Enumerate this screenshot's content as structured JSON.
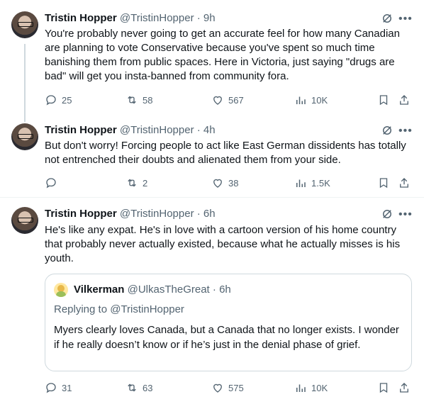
{
  "tweets": [
    {
      "name": "Tristin Hopper",
      "handle": "@TristinHopper",
      "time": "9h",
      "text": "You're probably never going to get an accurate feel for how many Canadian are planning to vote Conservative because you've spent so much time banishing them from public spaces. Here in Victoria, just saying \"drugs are bad\" will get you insta-banned from community fora.",
      "replies": "25",
      "reposts": "58",
      "likes": "567",
      "views": "10K"
    },
    {
      "name": "Tristin Hopper",
      "handle": "@TristinHopper",
      "time": "4h",
      "text": "But don't worry! Forcing people to act like East German dissidents has totally not entrenched their doubts and alienated them from your side.",
      "replies": "",
      "reposts": "2",
      "likes": "38",
      "views": "1.5K"
    },
    {
      "name": "Tristin Hopper",
      "handle": "@TristinHopper",
      "time": "6h",
      "text": "He's like any expat. He's in love with a cartoon version of his home country that probably never actually existed, because what he actually misses is his youth.",
      "replies": "31",
      "reposts": "63",
      "likes": "575",
      "views": "10K",
      "quote": {
        "name": "Vilkerman",
        "handle": "@UlkasTheGreat",
        "time": "6h",
        "replying_prefix": "Replying to ",
        "replying_to": "@TristinHopper",
        "text": "Myers clearly loves Canada, but a Canada that no longer exists. I wonder if he really doesn’t know or if he’s just in the denial phase of grief."
      }
    }
  ],
  "separator": " · ",
  "more_glyph": "•••",
  "colors": {
    "text": "#0f1419",
    "muted": "#536471",
    "line": "#cfd9de",
    "border": "#eff3f4"
  },
  "icons": [
    "grok-icon",
    "more-icon",
    "reply-icon",
    "repost-icon",
    "like-icon",
    "views-icon",
    "bookmark-icon",
    "share-icon"
  ]
}
